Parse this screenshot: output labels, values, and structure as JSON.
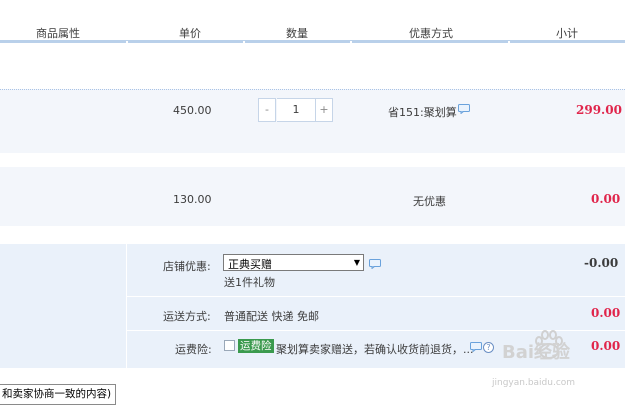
{
  "header": {
    "columns": [
      "商品属性",
      "单价",
      "数量",
      "优惠方式",
      "小计"
    ]
  },
  "items": [
    {
      "price": "450.00",
      "quantity": "1",
      "discount": "省151:聚划算",
      "subtotal": "299.00"
    },
    {
      "price": "130.00",
      "discount": "无优惠",
      "subtotal": "0.00"
    }
  ],
  "stepper": {
    "minus": "-",
    "plus": "+"
  },
  "shop_discount": {
    "label": "店铺优惠:",
    "selected": "正典买赠",
    "note": "送1件礼物",
    "amount": "-0.00"
  },
  "shipping": {
    "label": "运送方式:",
    "value": "普通配送 快递 免邮",
    "amount": "0.00"
  },
  "insurance": {
    "label": "运费险:",
    "tag": "运费险",
    "text": "聚划算卖家赠送，若确认收货前退货，...",
    "amount": "0.00"
  },
  "message_box": {
    "value": "和卖家协商一致的内容)"
  },
  "watermark": {
    "brand": "Bai经验",
    "url": "jingyan.baidu.com"
  },
  "colors": {
    "header_line": "#b9d0ea",
    "band_light": "#f3f6fb",
    "band_blue": "#eaf1fa",
    "price_red": "#e0254b",
    "tag_green": "#3b9a4e"
  }
}
